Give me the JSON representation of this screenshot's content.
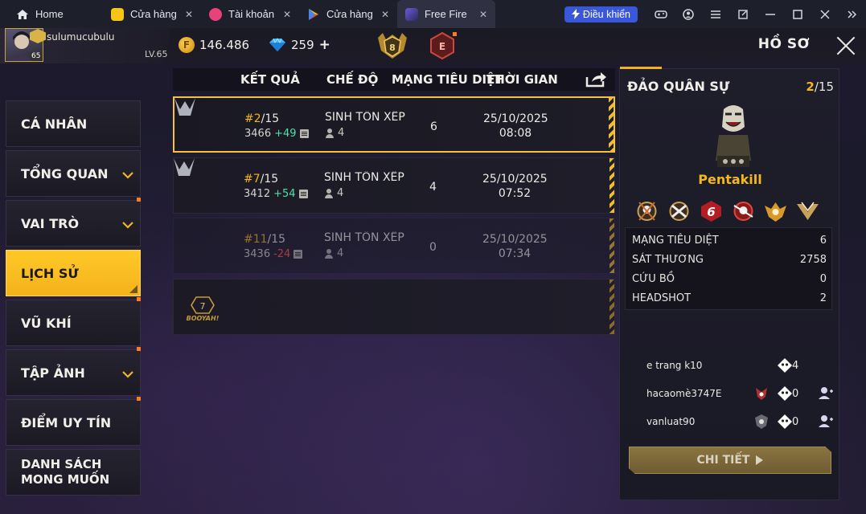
{
  "titlebar": {
    "home_label": "Home",
    "tabs": [
      {
        "label": "Cửa hàng ...",
        "close": "✕",
        "icon_color": "#f5c518"
      },
      {
        "label": "Tài khoản",
        "close": "✕",
        "icon_color": "#e8427a"
      },
      {
        "label": "Cửa hàng ...",
        "close": "✕",
        "icon_color": "#ffffff"
      },
      {
        "label": "Free Fire",
        "close": "✕",
        "icon_color": "#6c5bd8"
      }
    ],
    "control_label": "Điều khiển",
    "icons": [
      "gamepad-icon",
      "account-icon",
      "menu-icon",
      "popout-icon",
      "minimize-icon",
      "maximize-icon",
      "close-icon",
      "expand-sidebar-icon"
    ]
  },
  "player": {
    "name": "sulumucubulu",
    "level": "LV.65",
    "avatar_level": "65"
  },
  "currency": {
    "gold": "146.486",
    "diamonds": "259",
    "diamond_add": "+"
  },
  "header": {
    "title": "HỒ SƠ",
    "rank_badge_a": "8",
    "rank_badge_b": "E"
  },
  "sidebar": {
    "items": [
      {
        "label": "CÁ NHÂN",
        "chevron": false,
        "dot": false,
        "active": false
      },
      {
        "label": "TỔNG QUAN",
        "chevron": true,
        "dot": false,
        "active": false
      },
      {
        "label": "VAI TRÒ",
        "chevron": true,
        "dot": true,
        "active": false
      },
      {
        "label": "LỊCH SỬ",
        "chevron": false,
        "dot": false,
        "active": true
      },
      {
        "label": "VŨ KHÍ",
        "chevron": false,
        "dot": true,
        "active": false
      },
      {
        "label": "TẬP ẢNH",
        "chevron": true,
        "dot": true,
        "active": false
      },
      {
        "label": "ĐIỂM UY TÍN",
        "chevron": false,
        "dot": true,
        "active": false
      },
      {
        "label": "DANH SÁCH\nMONG MUỐN",
        "chevron": false,
        "dot": false,
        "active": false
      }
    ]
  },
  "history": {
    "columns": [
      "KẾT QUẢ",
      "CHẾ ĐỘ",
      "MẠNG TIÊU DIỆT",
      "THỜI GIAN"
    ],
    "matches": [
      {
        "place": "#2",
        "of": "/15",
        "score": "3466",
        "delta": "+49",
        "mode": "SINH TỒN XẾP HẠNG",
        "team": "4",
        "kills": "6",
        "date": "25/10/2025",
        "time": "08:08"
      },
      {
        "place": "#7",
        "of": "/15",
        "score": "3412",
        "delta": "+54",
        "mode": "SINH TỒN XẾP HẠNG",
        "team": "4",
        "kills": "4",
        "date": "25/10/2025",
        "time": "07:52"
      },
      {
        "place": "#11",
        "of": "/15",
        "score": "3436",
        "delta": "-24",
        "mode": "SINH TỒN XẾP HẠNG",
        "team": "4",
        "kills": "0",
        "date": "25/10/2025",
        "time": "07:34"
      }
    ],
    "booyah_count": "7",
    "booyah_label": "BOOYAH!"
  },
  "detail": {
    "title": "ĐẢO QUÂN SỰ",
    "rank": "2",
    "total": "/15",
    "character": "Pentakill",
    "medal_num": "6",
    "stats": [
      {
        "label": "MẠNG TIÊU DIỆT",
        "value": "6"
      },
      {
        "label": "SÁT THƯƠNG",
        "value": "2758"
      },
      {
        "label": "CỨU BỒ",
        "value": "0"
      },
      {
        "label": "HEADSHOT",
        "value": "2"
      }
    ],
    "team": [
      {
        "name": "e trang k10",
        "kills": "4",
        "badge": false,
        "add": false
      },
      {
        "name": "hacaomè3747E",
        "kills": "0",
        "badge": true,
        "add": true
      },
      {
        "name": "vanluat90",
        "kills": "0",
        "badge": true,
        "add": true
      }
    ],
    "button_label": "CHI TIẾT"
  },
  "colors": {
    "accent": "#f6b51f",
    "gain": "#4fe0a6",
    "loss": "#ff5a4c",
    "control_blue": "#3a56d9"
  }
}
